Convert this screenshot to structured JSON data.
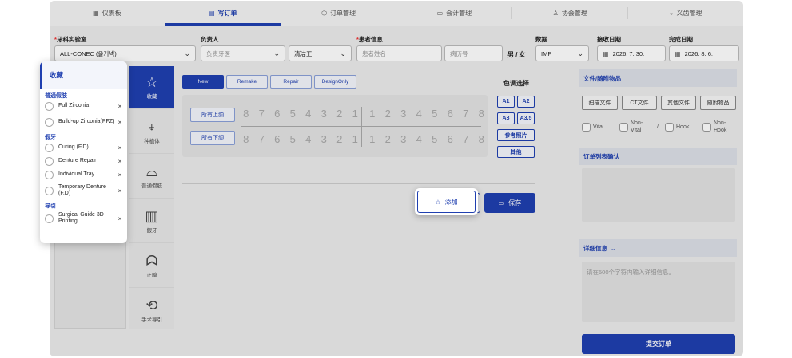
{
  "nav": {
    "tabs": [
      {
        "label": "仪表板",
        "icon": "dashboard-icon",
        "glyph": "▦"
      },
      {
        "label": "写订单",
        "icon": "document-icon",
        "glyph": "▤"
      },
      {
        "label": "订单管理",
        "icon": "box-icon",
        "glyph": "⬡"
      },
      {
        "label": "会计管理",
        "icon": "card-icon",
        "glyph": "▭"
      },
      {
        "label": "协会管理",
        "icon": "user-icon",
        "glyph": "♙"
      },
      {
        "label": "义齿管理",
        "icon": "tray-icon",
        "glyph": "◒"
      }
    ],
    "active": 1
  },
  "form": {
    "lab_label": "牙科实验室",
    "lab_value": "ALL-CONEC (올커넥)",
    "manager_label": "负责人",
    "dentist_placeholder": "负责牙医",
    "cleaner_value": "清洁工",
    "patient_label": "患者信息",
    "patient_name_placeholder": "患者姓名",
    "record_placeholder": "病历号",
    "sex_label": "男 / 女",
    "data_label": "数据",
    "data_value": "IMP",
    "receive_label": "接收日期",
    "receive_value": "2026. 7. 30.",
    "complete_label": "完成日期",
    "complete_value": "2026. 8. 6."
  },
  "categories": [
    {
      "label": "收藏",
      "glyph": "☆",
      "icon": "star-icon"
    },
    {
      "label": "种植体",
      "glyph": "⍖",
      "icon": "implant-icon"
    },
    {
      "label": "普通假肢",
      "glyph": "⌓",
      "icon": "crown-bridge-icon"
    },
    {
      "label": "假牙",
      "glyph": "▥",
      "icon": "denture-icon"
    },
    {
      "label": "正畸",
      "glyph": "ᗣ",
      "icon": "orthodontic-icon"
    },
    {
      "label": "手术导引",
      "glyph": "⟲",
      "icon": "surgical-guide-icon"
    }
  ],
  "order_types": [
    "New",
    "Remake",
    "Repair",
    "DesignOnly"
  ],
  "jaw": {
    "upper": "所有上颌",
    "lower": "所有下颌"
  },
  "teeth": {
    "left": [
      "8",
      "7",
      "6",
      "5",
      "4",
      "3",
      "2",
      "1"
    ],
    "right": [
      "1",
      "2",
      "3",
      "4",
      "5",
      "6",
      "7",
      "8"
    ]
  },
  "shade": {
    "label": "色调选择",
    "a1": "A1",
    "a2": "A2",
    "a3": "A3",
    "a35": "A3.5",
    "photo": "参考照片",
    "other": "其他"
  },
  "actions": {
    "add": "添加",
    "clear": "清除",
    "save": "保存"
  },
  "right": {
    "files_title": "文件/随附物品",
    "scan": "扫描文件",
    "ct": "CT文件",
    "other_items": "其他文件",
    "attach": "随附物品",
    "vital": "Vital",
    "non_vital": "Non-Vital",
    "slash": "/",
    "hook": "Hook",
    "non_hook": "Non-Hook",
    "confirm_title": "订单列表确认",
    "detail_title": "详细信息",
    "detail_placeholder": "请在500个字符内输入详细信息。",
    "submit": "提交订单"
  },
  "favorites": {
    "title": "收藏",
    "groups": [
      {
        "name": "普通假肢",
        "items": [
          "Full Zirconia",
          "Build-up Zirconia(PFZ)"
        ]
      },
      {
        "name": "假牙",
        "items": [
          "Curing (F.D)",
          "Denture Repair",
          "Individual Tray",
          "Temporary Denture (F.D)"
        ]
      },
      {
        "name": "导引",
        "items": [
          "Surgical Guide 3D Printing"
        ]
      }
    ]
  }
}
